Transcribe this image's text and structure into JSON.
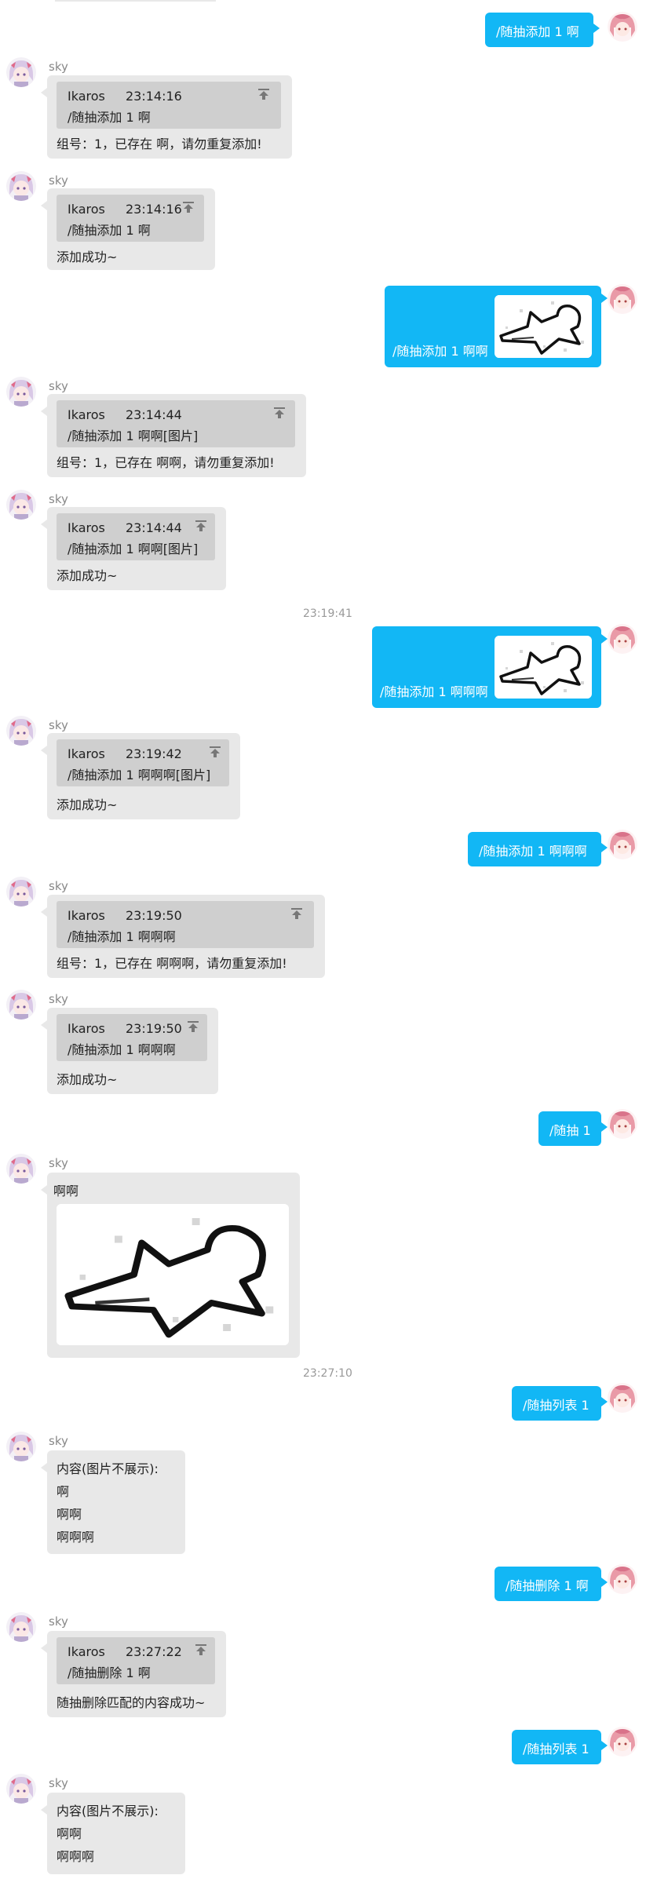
{
  "sender": "sky",
  "reply_author": "Ikaros",
  "messages": {
    "m1": {
      "text": "/随抽添加 1 啊"
    },
    "m2": {
      "reply_time": "23:14:16",
      "reply_text": "/随抽添加 1 啊",
      "text": "组号：1，已存在 啊，请勿重复添加!"
    },
    "m3": {
      "reply_time": "23:14:16",
      "reply_text": "/随抽添加 1 啊",
      "text": "添加成功~"
    },
    "m4": {
      "text": "/随抽添加 1 啊啊"
    },
    "m5": {
      "reply_time": "23:14:44",
      "reply_text": "/随抽添加 1 啊啊[图片]",
      "text": "组号：1，已存在 啊啊，请勿重复添加!"
    },
    "m6": {
      "reply_time": "23:14:44",
      "reply_text": "/随抽添加 1 啊啊[图片]",
      "text": "添加成功~"
    },
    "t1": "23:19:41",
    "m7": {
      "text": "/随抽添加 1 啊啊啊"
    },
    "m8": {
      "reply_time": "23:19:42",
      "reply_text": "/随抽添加 1 啊啊啊[图片]",
      "text": "添加成功~"
    },
    "m9": {
      "text": "/随抽添加 1 啊啊啊"
    },
    "m10": {
      "reply_time": "23:19:50",
      "reply_text": "/随抽添加 1 啊啊啊",
      "text": "组号：1，已存在 啊啊啊，请勿重复添加!"
    },
    "m11": {
      "reply_time": "23:19:50",
      "reply_text": "/随抽添加 1 啊啊啊",
      "text": "添加成功~"
    },
    "m12": {
      "text": "/随抽 1"
    },
    "m13": {
      "text": "啊啊"
    },
    "t2": "23:27:10",
    "m14": {
      "text": "/随抽列表 1"
    },
    "m15": {
      "lines": [
        "内容(图片不展示):",
        "啊",
        "啊啊",
        "啊啊啊"
      ]
    },
    "m16": {
      "text": "/随抽删除 1 啊"
    },
    "m17": {
      "reply_time": "23:27:22",
      "reply_text": "/随抽删除 1 啊",
      "text": "随抽删除匹配的内容成功~"
    },
    "m18": {
      "text": "/随抽列表 1"
    },
    "m19": {
      "lines": [
        "内容(图片不展示):",
        "啊啊",
        "啊啊啊"
      ]
    }
  },
  "colors": {
    "self_bubble": "#12b7f5",
    "bot_bubble": "#e8e8e8",
    "quote": "#cfcfcf"
  },
  "icons": [
    "pin-top-icon",
    "avatar-icon",
    "sticker-image"
  ]
}
